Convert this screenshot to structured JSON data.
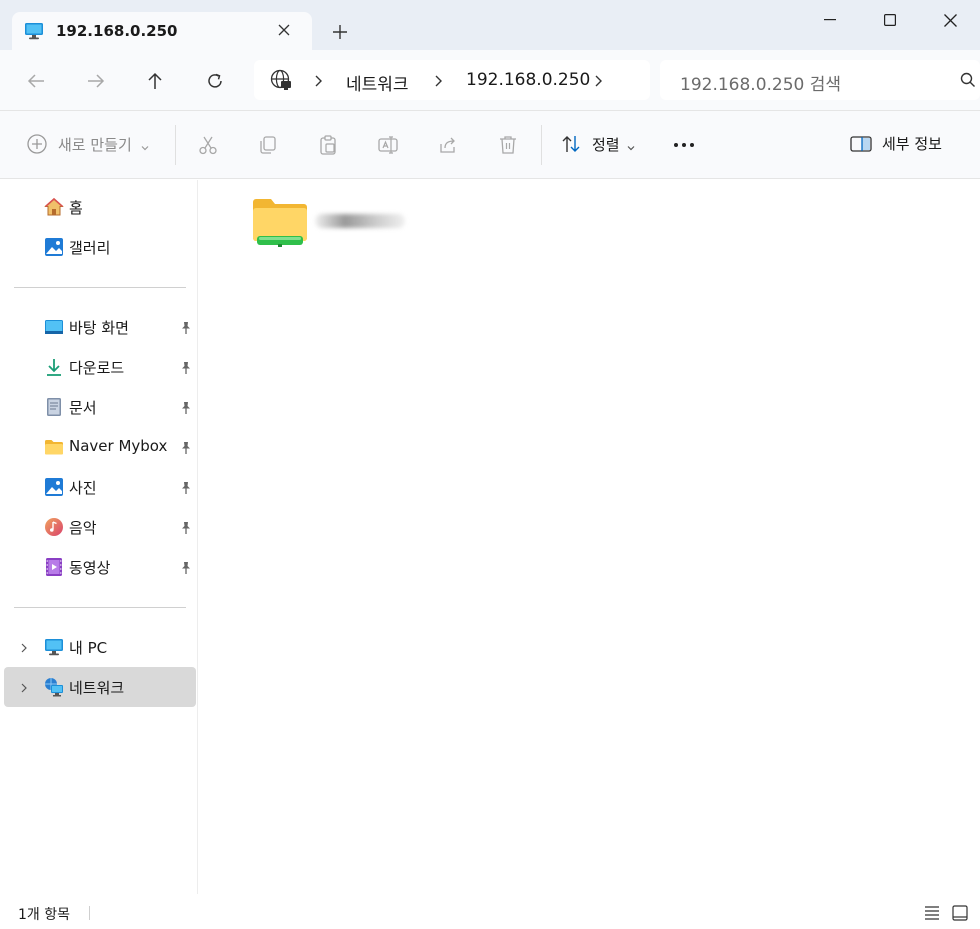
{
  "tab": {
    "title": "192.168.0.250"
  },
  "address": {
    "parts": [
      "네트워크",
      "192.168.0.250"
    ]
  },
  "search": {
    "placeholder": "192.168.0.250 검색"
  },
  "toolbar": {
    "new_label": "새로 만들기",
    "sort_label": "정렬",
    "details_label": "세부 정보"
  },
  "sidebar": {
    "items": [
      {
        "label": "홈",
        "icon": "home-icon"
      },
      {
        "label": "갤러리",
        "icon": "gallery-icon"
      },
      {
        "label": "바탕 화면",
        "icon": "desktop-icon",
        "pinned": true
      },
      {
        "label": "다운로드",
        "icon": "download-icon",
        "pinned": true
      },
      {
        "label": "문서",
        "icon": "document-icon",
        "pinned": true
      },
      {
        "label": "Naver Mybox",
        "icon": "folder-icon",
        "pinned": true
      },
      {
        "label": "사진",
        "icon": "pictures-icon",
        "pinned": true
      },
      {
        "label": "음악",
        "icon": "music-icon",
        "pinned": true
      },
      {
        "label": "동영상",
        "icon": "video-icon",
        "pinned": true
      },
      {
        "label": "내 PC",
        "icon": "this-pc-icon"
      },
      {
        "label": "네트워크",
        "icon": "network-icon",
        "selected": true
      }
    ]
  },
  "status": {
    "count": "1개 항목"
  },
  "colors": {
    "accent": "#0067c0",
    "selected_bg": "#d9d9d9",
    "titlebar_bg": "#e9eef5"
  }
}
